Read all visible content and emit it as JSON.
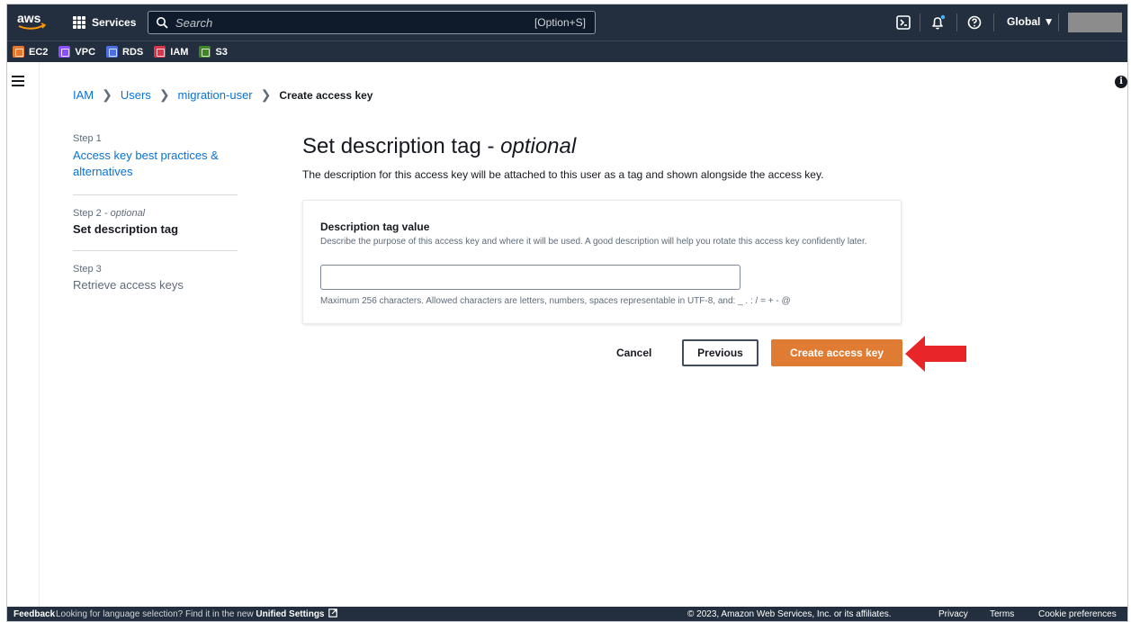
{
  "topnav": {
    "logo": "aws",
    "services_label": "Services",
    "search_placeholder": "Search",
    "search_shortcut": "[Option+S]",
    "region": "Global ▼",
    "icons": [
      "cloudshell-icon",
      "bell-icon",
      "help-icon"
    ]
  },
  "favorites": [
    {
      "label": "EC2",
      "color": "#e8772e"
    },
    {
      "label": "VPC",
      "color": "#8c4fff"
    },
    {
      "label": "RDS",
      "color": "#4c6fe3"
    },
    {
      "label": "IAM",
      "color": "#dd344c"
    },
    {
      "label": "S3",
      "color": "#3f8624"
    }
  ],
  "breadcrumb": {
    "items": [
      "IAM",
      "Users",
      "migration-user"
    ],
    "current": "Create access key"
  },
  "steps": [
    {
      "num": "Step 1",
      "title": "Access key best practices & alternatives"
    },
    {
      "num": "Step 2",
      "num_suffix": "- optional",
      "title": "Set description tag"
    },
    {
      "num": "Step 3",
      "title": "Retrieve access keys"
    }
  ],
  "main": {
    "title": "Set description tag - ",
    "title_em": "optional",
    "description": "The description for this access key will be attached to this user as a tag and shown alongside the access key.",
    "field_label": "Description tag value",
    "field_help": "Describe the purpose of this access key and where it will be used. A good description will help you rotate this access key confidently later.",
    "field_value": "",
    "field_constraint": "Maximum 256 characters. Allowed characters are letters, numbers, spaces representable in UTF-8, and: _ . : / = + - @"
  },
  "actions": {
    "cancel": "Cancel",
    "previous": "Previous",
    "primary": "Create access key"
  },
  "footer": {
    "feedback": "Feedback",
    "lang_text": "Looking for language selection? Find it in the new ",
    "lang_link": "Unified Settings",
    "copyright": "© 2023, Amazon Web Services, Inc. or its affiliates.",
    "privacy": "Privacy",
    "terms": "Terms",
    "cookies": "Cookie preferences"
  }
}
